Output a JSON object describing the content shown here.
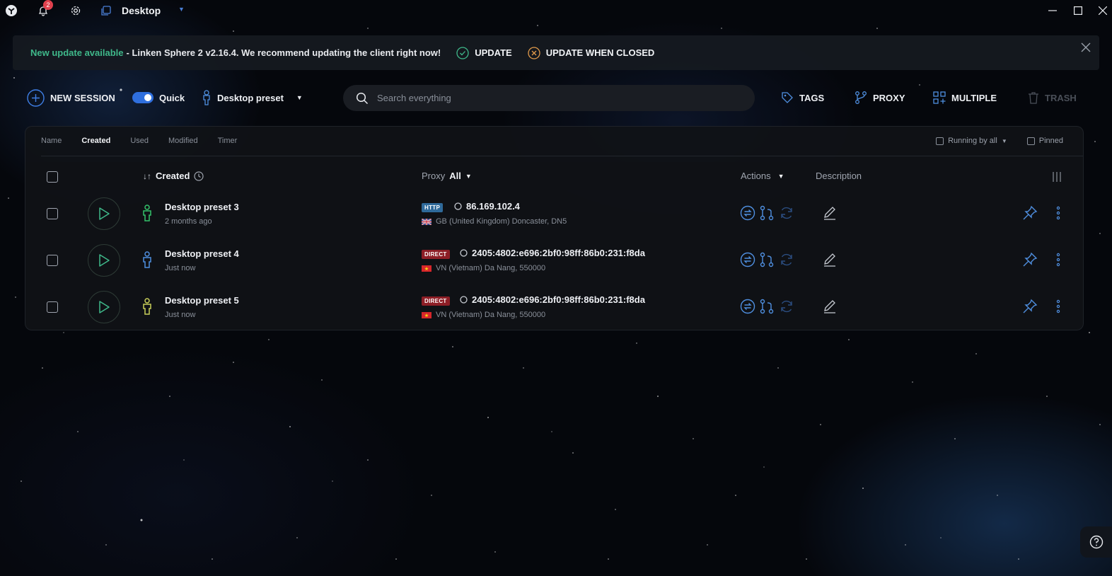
{
  "topbar": {
    "notifications_count": "2",
    "tab_title": "Desktop"
  },
  "banner": {
    "highlight": "New update available",
    "message": "- Linken Sphere 2 v2.16.4. We recommend updating the client right now!",
    "update_label": "UPDATE",
    "update_closed_label": "UPDATE WHEN CLOSED"
  },
  "toolbar": {
    "new_session": "NEW SESSION",
    "quick": "Quick",
    "preset": "Desktop preset",
    "search_placeholder": "Search everything",
    "tags": "TAGS",
    "proxy": "PROXY",
    "multiple": "MULTIPLE",
    "trash": "TRASH"
  },
  "sort_tabs": [
    "Name",
    "Created",
    "Used",
    "Modified",
    "Timer"
  ],
  "filters": {
    "running": "Running by all",
    "pinned": "Pinned"
  },
  "table_header": {
    "created": "Created",
    "proxy": "Proxy",
    "proxy_filter": "All",
    "actions": "Actions",
    "description": "Description"
  },
  "sessions": [
    {
      "name": "Desktop preset 3",
      "time": "2 months ago",
      "proxy_type": "HTTP",
      "address": "86.169.102.4",
      "location": "GB (United Kingdom) Doncaster, DN5",
      "icon_color": "#34c36b"
    },
    {
      "name": "Desktop preset 4",
      "time": "Just now",
      "proxy_type": "DIRECT",
      "address": "2405:4802:e696:2bf0:98ff:86b0:231:f8da",
      "location": "VN (Vietnam) Da Nang, 550000",
      "icon_color": "#4f8fe0"
    },
    {
      "name": "Desktop preset 5",
      "time": "Just now",
      "proxy_type": "DIRECT",
      "address": "2405:4802:e696:2bf0:98ff:86b0:231:f8da",
      "location": "VN (Vietnam) Da Nang, 550000",
      "icon_color": "#c8cf5a"
    }
  ],
  "colors": {
    "accent": "#2f6fde",
    "banner_highlight": "#3fb88a",
    "update_icon": "#3fb88a",
    "update_closed_icon": "#e09a4b",
    "direct_tag": "#8d1e26",
    "http_tag": "#2f6a9a"
  }
}
